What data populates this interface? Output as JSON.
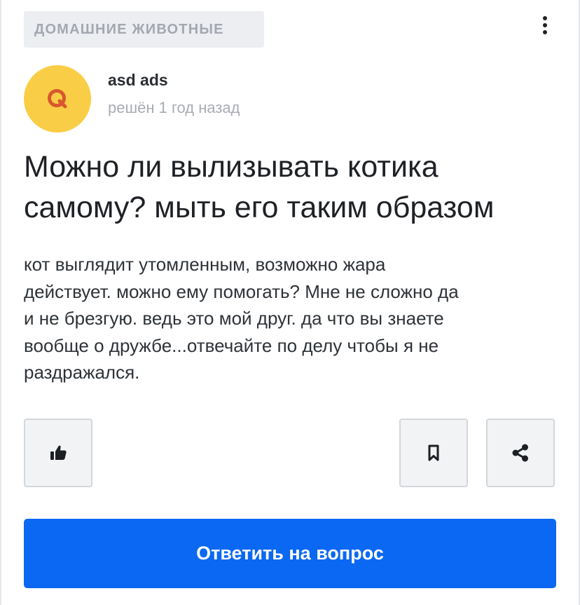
{
  "category": {
    "label": "ДОМАШНИЕ ЖИВОТНЫЕ"
  },
  "more_menu": {
    "icon": "more-vertical-icon"
  },
  "author": {
    "avatar_letter": "Q",
    "avatar_color": "#f9ce46",
    "name": "asd ads",
    "status": "решён 1 год назад"
  },
  "question": {
    "title_lines": [
      "Можно ли вылизывать котика",
      "самому? мыть его таким образом"
    ],
    "body_lines": [
      "кот выглядит утомленным, возможно жара",
      "действует. можно ему помогать? Мне не сложно да",
      "и не брезгую. ведь это мой друг. да что вы знаете",
      "вообще о дружбе...отвечайте по делу  чтобы я не",
      "раздражался."
    ]
  },
  "actions": {
    "like_icon": "thumbs-up-icon",
    "bookmark_icon": "bookmark-icon",
    "share_icon": "share-icon",
    "answer_label": "Ответить на вопрос",
    "answer_color": "#0a68f2"
  }
}
